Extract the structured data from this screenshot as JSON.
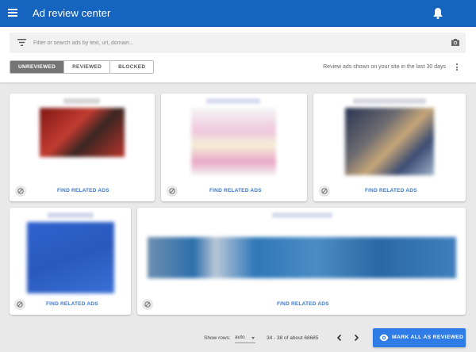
{
  "app": {
    "title": "Ad review center"
  },
  "icons": {
    "menu": "hamburger-menu-icon",
    "notifications": "bell-icon",
    "filter": "filter-icon",
    "image_search": "camera-icon",
    "more": "more-vert-icon",
    "block": "block-icon",
    "prev": "chevron-left-icon",
    "next": "chevron-right-icon",
    "reviewed": "eye-icon"
  },
  "search": {
    "placeholder": "Filter or search ads by text, url, domain..."
  },
  "tabs": [
    {
      "label": "UNREVIEWED",
      "active": true
    },
    {
      "label": "REVIEWED",
      "active": false
    },
    {
      "label": "BLOCKED",
      "active": false
    }
  ],
  "review_note": "Review ads shown on your site in the last 30 days",
  "ads": [
    {
      "related_label": "FIND RELATED ADS",
      "thumbnail_color": "#b7332b"
    },
    {
      "related_label": "FIND RELATED ADS",
      "thumbnail_color": "#f0d6e3"
    },
    {
      "related_label": "FIND RELATED ADS",
      "thumbnail_color": "#4b5a78"
    },
    {
      "related_label": "FIND RELATED ADS",
      "thumbnail_color": "#2f62c9"
    },
    {
      "related_label": "FIND RELATED ADS",
      "thumbnail_color": "#2d6fb0"
    }
  ],
  "footer": {
    "rows_label": "Show rows:",
    "rows_value": "auto",
    "range": "34 - 38 of about 68685",
    "mark_all_label": "MARK ALL AS REVIEWED"
  },
  "colors": {
    "app_bar": "#1565c0",
    "accent_button": "#2f7ce6",
    "link": "#3b78c9",
    "active_tab": "#757575"
  }
}
